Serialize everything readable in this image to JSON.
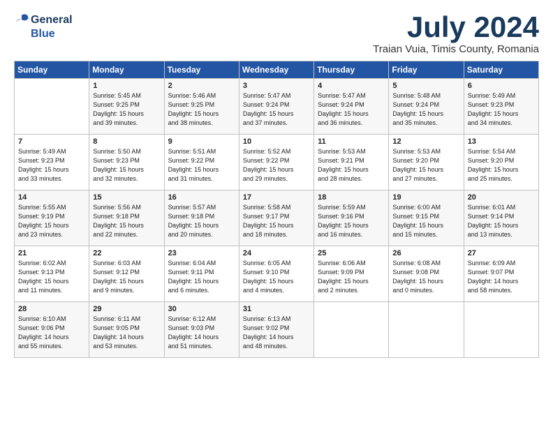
{
  "logo": {
    "line1": "General",
    "line2": "Blue"
  },
  "title": "July 2024",
  "subtitle": "Traian Vuia, Timis County, Romania",
  "days_of_week": [
    "Sunday",
    "Monday",
    "Tuesday",
    "Wednesday",
    "Thursday",
    "Friday",
    "Saturday"
  ],
  "weeks": [
    [
      {
        "day": "",
        "content": ""
      },
      {
        "day": "1",
        "content": "Sunrise: 5:45 AM\nSunset: 9:25 PM\nDaylight: 15 hours\nand 39 minutes."
      },
      {
        "day": "2",
        "content": "Sunrise: 5:46 AM\nSunset: 9:25 PM\nDaylight: 15 hours\nand 38 minutes."
      },
      {
        "day": "3",
        "content": "Sunrise: 5:47 AM\nSunset: 9:24 PM\nDaylight: 15 hours\nand 37 minutes."
      },
      {
        "day": "4",
        "content": "Sunrise: 5:47 AM\nSunset: 9:24 PM\nDaylight: 15 hours\nand 36 minutes."
      },
      {
        "day": "5",
        "content": "Sunrise: 5:48 AM\nSunset: 9:24 PM\nDaylight: 15 hours\nand 35 minutes."
      },
      {
        "day": "6",
        "content": "Sunrise: 5:49 AM\nSunset: 9:23 PM\nDaylight: 15 hours\nand 34 minutes."
      }
    ],
    [
      {
        "day": "7",
        "content": "Sunrise: 5:49 AM\nSunset: 9:23 PM\nDaylight: 15 hours\nand 33 minutes."
      },
      {
        "day": "8",
        "content": "Sunrise: 5:50 AM\nSunset: 9:23 PM\nDaylight: 15 hours\nand 32 minutes."
      },
      {
        "day": "9",
        "content": "Sunrise: 5:51 AM\nSunset: 9:22 PM\nDaylight: 15 hours\nand 31 minutes."
      },
      {
        "day": "10",
        "content": "Sunrise: 5:52 AM\nSunset: 9:22 PM\nDaylight: 15 hours\nand 29 minutes."
      },
      {
        "day": "11",
        "content": "Sunrise: 5:53 AM\nSunset: 9:21 PM\nDaylight: 15 hours\nand 28 minutes."
      },
      {
        "day": "12",
        "content": "Sunrise: 5:53 AM\nSunset: 9:20 PM\nDaylight: 15 hours\nand 27 minutes."
      },
      {
        "day": "13",
        "content": "Sunrise: 5:54 AM\nSunset: 9:20 PM\nDaylight: 15 hours\nand 25 minutes."
      }
    ],
    [
      {
        "day": "14",
        "content": "Sunrise: 5:55 AM\nSunset: 9:19 PM\nDaylight: 15 hours\nand 23 minutes."
      },
      {
        "day": "15",
        "content": "Sunrise: 5:56 AM\nSunset: 9:18 PM\nDaylight: 15 hours\nand 22 minutes."
      },
      {
        "day": "16",
        "content": "Sunrise: 5:57 AM\nSunset: 9:18 PM\nDaylight: 15 hours\nand 20 minutes."
      },
      {
        "day": "17",
        "content": "Sunrise: 5:58 AM\nSunset: 9:17 PM\nDaylight: 15 hours\nand 18 minutes."
      },
      {
        "day": "18",
        "content": "Sunrise: 5:59 AM\nSunset: 9:16 PM\nDaylight: 15 hours\nand 16 minutes."
      },
      {
        "day": "19",
        "content": "Sunrise: 6:00 AM\nSunset: 9:15 PM\nDaylight: 15 hours\nand 15 minutes."
      },
      {
        "day": "20",
        "content": "Sunrise: 6:01 AM\nSunset: 9:14 PM\nDaylight: 15 hours\nand 13 minutes."
      }
    ],
    [
      {
        "day": "21",
        "content": "Sunrise: 6:02 AM\nSunset: 9:13 PM\nDaylight: 15 hours\nand 11 minutes."
      },
      {
        "day": "22",
        "content": "Sunrise: 6:03 AM\nSunset: 9:12 PM\nDaylight: 15 hours\nand 9 minutes."
      },
      {
        "day": "23",
        "content": "Sunrise: 6:04 AM\nSunset: 9:11 PM\nDaylight: 15 hours\nand 6 minutes."
      },
      {
        "day": "24",
        "content": "Sunrise: 6:05 AM\nSunset: 9:10 PM\nDaylight: 15 hours\nand 4 minutes."
      },
      {
        "day": "25",
        "content": "Sunrise: 6:06 AM\nSunset: 9:09 PM\nDaylight: 15 hours\nand 2 minutes."
      },
      {
        "day": "26",
        "content": "Sunrise: 6:08 AM\nSunset: 9:08 PM\nDaylight: 15 hours\nand 0 minutes."
      },
      {
        "day": "27",
        "content": "Sunrise: 6:09 AM\nSunset: 9:07 PM\nDaylight: 14 hours\nand 58 minutes."
      }
    ],
    [
      {
        "day": "28",
        "content": "Sunrise: 6:10 AM\nSunset: 9:06 PM\nDaylight: 14 hours\nand 55 minutes."
      },
      {
        "day": "29",
        "content": "Sunrise: 6:11 AM\nSunset: 9:05 PM\nDaylight: 14 hours\nand 53 minutes."
      },
      {
        "day": "30",
        "content": "Sunrise: 6:12 AM\nSunset: 9:03 PM\nDaylight: 14 hours\nand 51 minutes."
      },
      {
        "day": "31",
        "content": "Sunrise: 6:13 AM\nSunset: 9:02 PM\nDaylight: 14 hours\nand 48 minutes."
      },
      {
        "day": "",
        "content": ""
      },
      {
        "day": "",
        "content": ""
      },
      {
        "day": "",
        "content": ""
      }
    ]
  ]
}
